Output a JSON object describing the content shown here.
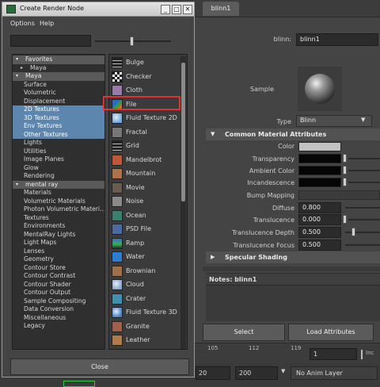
{
  "attr_editor": {
    "tab": "blinn1",
    "name_label": "blinn:",
    "name_value": "blinn1",
    "sample_label": "Sample",
    "type_label": "Type",
    "type_value": "Blinn",
    "common_section": "Common Material Attributes",
    "attrs": {
      "color": "Color",
      "transparency": "Transparency",
      "ambient": "Ambient Color",
      "incandescence": "Incandescence",
      "bump": "Bump Mapping",
      "diffuse": "Diffuse",
      "diffuse_val": "0.800",
      "translucence": "Translucence",
      "translucence_val": "0.000",
      "trans_depth": "Translucence Depth",
      "trans_depth_val": "0.500",
      "trans_focus": "Translucence Focus",
      "trans_focus_val": "0.500"
    },
    "specular_section": "Specular Shading",
    "notes": "Notes:  blinn1",
    "select_btn": "Select",
    "load_btn": "Load Attributes",
    "timeline_ticks": [
      "105",
      "112",
      "119"
    ],
    "current_frame": "1",
    "range_start": "20",
    "range_end": "200",
    "anim_layer": "No Anim Layer",
    "inc_label": "Inc"
  },
  "dialog": {
    "title": "Create Render Node",
    "menus": [
      "Options",
      "Help"
    ],
    "close_label": "Close",
    "tree": [
      {
        "label": "Favorites",
        "kind": "hdr",
        "arrow": "▾"
      },
      {
        "label": "Maya",
        "kind": "sub",
        "arrow": "▸"
      },
      {
        "label": "Maya",
        "kind": "hdr",
        "arrow": "▾"
      },
      {
        "label": "Surface",
        "kind": "item"
      },
      {
        "label": "Volumetric",
        "kind": "item"
      },
      {
        "label": "Displacement",
        "kind": "item"
      },
      {
        "label": "2D Textures",
        "kind": "sel"
      },
      {
        "label": "3D Textures",
        "kind": "sel"
      },
      {
        "label": "Env Textures",
        "kind": "sel"
      },
      {
        "label": "Other Textures",
        "kind": "sel"
      },
      {
        "label": "Lights",
        "kind": "item"
      },
      {
        "label": "Utilities",
        "kind": "item"
      },
      {
        "label": "Image Planes",
        "kind": "item"
      },
      {
        "label": "Glow",
        "kind": "item"
      },
      {
        "label": "Rendering",
        "kind": "item"
      },
      {
        "label": "mental ray",
        "kind": "hdr",
        "arrow": "▾"
      },
      {
        "label": "Materials",
        "kind": "item"
      },
      {
        "label": "Volumetric Materials",
        "kind": "item"
      },
      {
        "label": "Photon Volumetric Materi...",
        "kind": "item"
      },
      {
        "label": "Textures",
        "kind": "item"
      },
      {
        "label": "Environments",
        "kind": "item"
      },
      {
        "label": "MentalRay Lights",
        "kind": "item"
      },
      {
        "label": "Light Maps",
        "kind": "item"
      },
      {
        "label": "Lenses",
        "kind": "item"
      },
      {
        "label": "Geometry",
        "kind": "item"
      },
      {
        "label": "Contour Store",
        "kind": "item"
      },
      {
        "label": "Contour Contrast",
        "kind": "item"
      },
      {
        "label": "Contour Shader",
        "kind": "item"
      },
      {
        "label": "Contour Output",
        "kind": "item"
      },
      {
        "label": "Sample Compositing",
        "kind": "item"
      },
      {
        "label": "Data Conversion",
        "kind": "item"
      },
      {
        "label": "Miscellaneous",
        "kind": "item"
      },
      {
        "label": "Legacy",
        "kind": "item"
      }
    ],
    "nodes": [
      {
        "label": "Bulge",
        "icon": "bulge-icon",
        "color": "#222222"
      },
      {
        "label": "Checker",
        "icon": "checker-icon",
        "color": "#ffffff"
      },
      {
        "label": "Cloth",
        "icon": "cloth-icon",
        "color": "#9a7aa8"
      },
      {
        "label": "File",
        "icon": "file-icon",
        "color": "#3b7a3a"
      },
      {
        "label": "Fluid Texture 2D",
        "icon": "fluid-texture-2d-icon",
        "color": "#6fa8d8"
      },
      {
        "label": "Fractal",
        "icon": "fractal-icon",
        "color": "#777777"
      },
      {
        "label": "Grid",
        "icon": "grid-icon",
        "color": "#444444"
      },
      {
        "label": "Mandelbrot",
        "icon": "mandelbrot-icon",
        "color": "#c0563a"
      },
      {
        "label": "Mountain",
        "icon": "mountain-icon",
        "color": "#b0704a"
      },
      {
        "label": "Movie",
        "icon": "movie-icon",
        "color": "#6a5a50"
      },
      {
        "label": "Noise",
        "icon": "noise-icon",
        "color": "#8a8a8a"
      },
      {
        "label": "Ocean",
        "icon": "ocean-icon",
        "color": "#3d7f6f"
      },
      {
        "label": "PSD File",
        "icon": "psd-file-icon",
        "color": "#4a6aa0"
      },
      {
        "label": "Ramp",
        "icon": "ramp-icon",
        "color": "#3cb04a"
      },
      {
        "label": "Water",
        "icon": "water-icon",
        "color": "#2f7bd0"
      },
      {
        "label": "Brownian",
        "icon": "brownian-icon",
        "color": "#a0704a"
      },
      {
        "label": "Cloud",
        "icon": "cloud-icon",
        "color": "#8aa6c8"
      },
      {
        "label": "Crater",
        "icon": "crater-icon",
        "color": "#3f8fb0"
      },
      {
        "label": "Fluid Texture 3D",
        "icon": "fluid-texture-3d-icon",
        "color": "#4a80c0"
      },
      {
        "label": "Granite",
        "icon": "granite-icon",
        "color": "#a0604a"
      },
      {
        "label": "Leather",
        "icon": "leather-icon",
        "color": "#b07a4a"
      }
    ]
  }
}
